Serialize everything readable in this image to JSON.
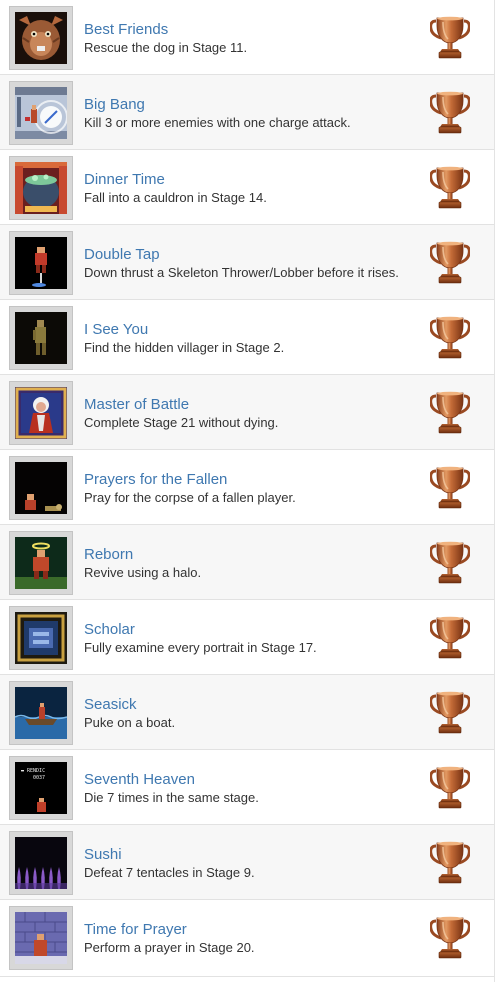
{
  "trophies": [
    {
      "title": "Best Friends",
      "description": "Rescue the dog in Stage 11.",
      "image": "rat-creature-portrait",
      "trophy_icon": "bronze-trophy-icon"
    },
    {
      "title": "Big Bang",
      "description": "Kill 3 or more enemies with one charge attack.",
      "image": "charge-attack-scene",
      "trophy_icon": "bronze-trophy-icon"
    },
    {
      "title": "Dinner Time",
      "description": "Fall into a cauldron in Stage 14.",
      "image": "cauldron-scene",
      "trophy_icon": "bronze-trophy-icon"
    },
    {
      "title": "Double Tap",
      "description": "Down thrust a Skeleton Thrower/Lobber before it rises.",
      "image": "down-thrust-scene",
      "trophy_icon": "bronze-trophy-icon"
    },
    {
      "title": "I See You",
      "description": "Find the hidden villager in Stage 2.",
      "image": "hidden-villager-scene",
      "trophy_icon": "bronze-trophy-icon"
    },
    {
      "title": "Master of Battle",
      "description": "Complete Stage 21 without dying.",
      "image": "throne-king-scene",
      "trophy_icon": "bronze-trophy-icon"
    },
    {
      "title": "Prayers for the Fallen",
      "description": "Pray for the corpse of a fallen player.",
      "image": "praying-scene",
      "trophy_icon": "bronze-trophy-icon"
    },
    {
      "title": "Reborn",
      "description": "Revive using a halo.",
      "image": "halo-revive-scene",
      "trophy_icon": "bronze-trophy-icon"
    },
    {
      "title": "Scholar",
      "description": "Fully examine every portrait in Stage 17.",
      "image": "portrait-frame-scene",
      "trophy_icon": "bronze-trophy-icon"
    },
    {
      "title": "Seasick",
      "description": "Puke on a boat.",
      "image": "boat-scene",
      "trophy_icon": "bronze-trophy-icon"
    },
    {
      "title": "Seventh Heaven",
      "description": "Die 7 times in the same stage.",
      "image": "seventh-heaven-scene",
      "trophy_icon": "bronze-trophy-icon"
    },
    {
      "title": "Sushi",
      "description": "Defeat 7 tentacles in Stage 9.",
      "image": "tentacles-scene",
      "trophy_icon": "bronze-trophy-icon"
    },
    {
      "title": "Time for Prayer",
      "description": "Perform a prayer in Stage 20.",
      "image": "prayer-temple-scene",
      "trophy_icon": "bronze-trophy-icon"
    }
  ],
  "thumb_texts": {
    "seventh_heaven_line1": "▬ RENDIC",
    "seventh_heaven_line2": "0037"
  },
  "colors": {
    "title_link": "#3f78b0",
    "description_text": "#333333",
    "row_alt_bg": "#f7f7f7",
    "trophy_bronze": "#c06a38"
  }
}
